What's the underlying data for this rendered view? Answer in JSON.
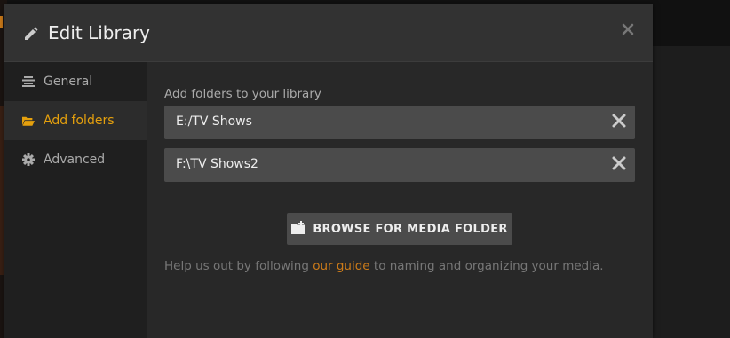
{
  "modal": {
    "title": "Edit Library",
    "close_icon": "close-icon",
    "title_icon": "pencil-icon"
  },
  "sidebar": {
    "items": [
      {
        "label": "General",
        "icon": "list-icon",
        "active": false
      },
      {
        "label": "Add folders",
        "icon": "folder-open-icon",
        "active": true
      },
      {
        "label": "Advanced",
        "icon": "gear-icon",
        "active": false
      }
    ]
  },
  "content": {
    "section_label": "Add folders to your library",
    "folders": [
      {
        "path": "E:/TV Shows"
      },
      {
        "path": "F:\\TV Shows2"
      }
    ],
    "browse_button_label": "BROWSE FOR MEDIA FOLDER",
    "help": {
      "before": "Help us out by following ",
      "link": "our guide",
      "after": " to naming and organizing your media."
    }
  },
  "colors": {
    "accent": "#e5a00d",
    "link": "#cc7b19",
    "modal_bg": "#282828",
    "header_bg": "#323232",
    "sidebar_bg": "#1f1f1f",
    "field_bg": "#4b4b4b"
  }
}
